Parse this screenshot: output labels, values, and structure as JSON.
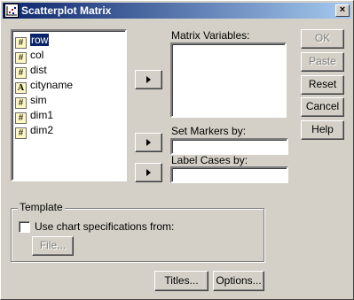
{
  "window": {
    "title": "Scatterplot Matrix",
    "close_label": "×"
  },
  "variables": [
    {
      "name": "row",
      "type": "numeric",
      "selected": true
    },
    {
      "name": "col",
      "type": "numeric",
      "selected": false
    },
    {
      "name": "dist",
      "type": "numeric",
      "selected": false
    },
    {
      "name": "cityname",
      "type": "string",
      "selected": false
    },
    {
      "name": "sim",
      "type": "numeric",
      "selected": false
    },
    {
      "name": "dim1",
      "type": "numeric",
      "selected": false
    },
    {
      "name": "dim2",
      "type": "numeric",
      "selected": false
    }
  ],
  "icons": {
    "numeric": "#",
    "string": "A"
  },
  "labels": {
    "matrix_variables": "Matrix Variables:",
    "set_markers_by": "Set Markers by:",
    "label_cases_by": "Label Cases by:"
  },
  "fields": {
    "matrix_variables": "",
    "set_markers_by": "",
    "label_cases_by": ""
  },
  "buttons": {
    "ok": "OK",
    "paste": "Paste",
    "reset": "Reset",
    "cancel": "Cancel",
    "help": "Help",
    "titles": "Titles...",
    "options": "Options...",
    "file": "File..."
  },
  "template": {
    "legend": "Template",
    "checkbox_label": "Use chart specifications from:",
    "checked": false
  }
}
